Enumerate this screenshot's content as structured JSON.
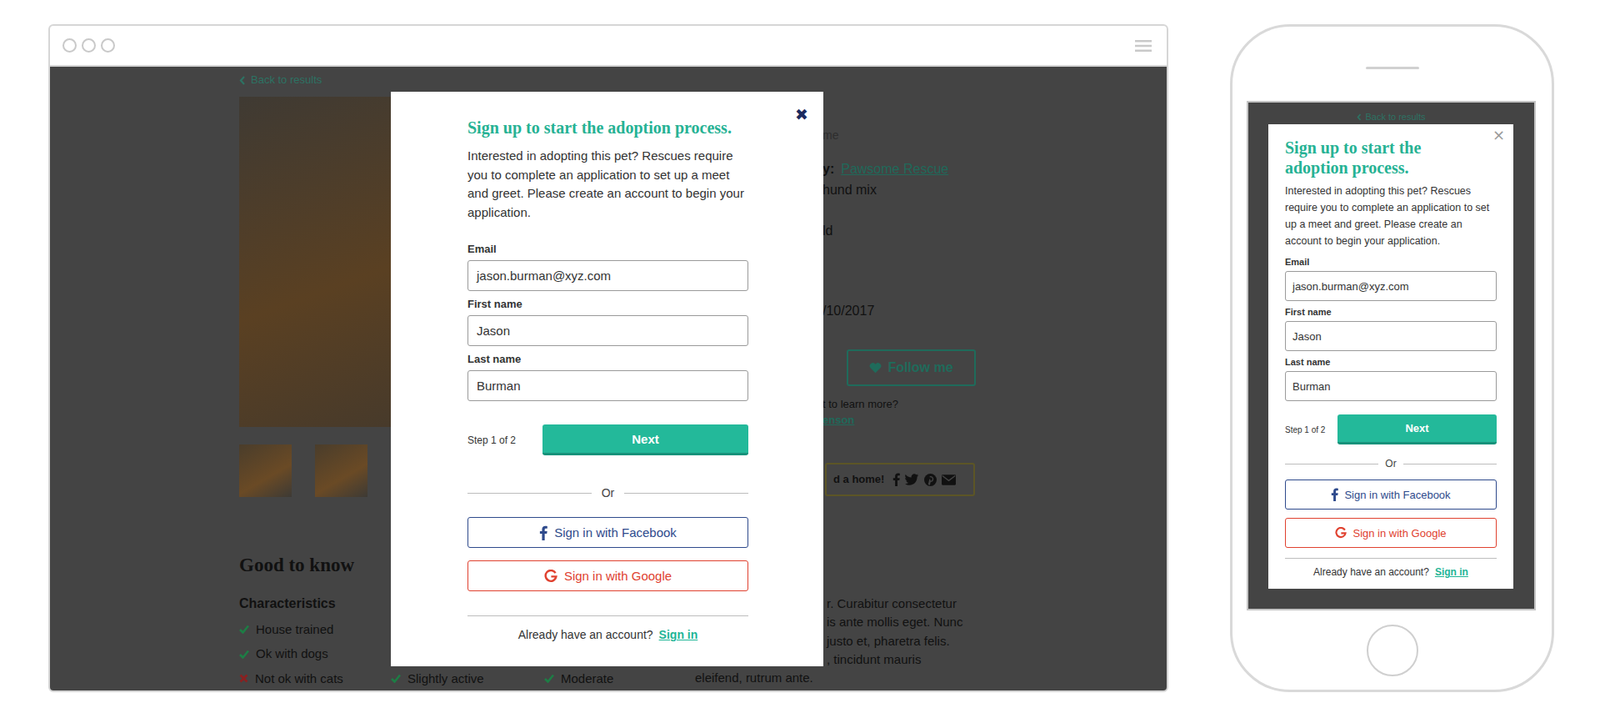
{
  "page": {
    "back_link": "Back to results",
    "details": {
      "faded": "me",
      "rescue_label": "y:",
      "rescue_link": "Pawsome Rescue",
      "breed": "hund mix",
      "age": "ld",
      "date": "/10/2017",
      "follow": "Follow me",
      "learn_more": "t to learn more?",
      "contact_link": "enson",
      "share_text": "d a home!"
    },
    "good_to_know": "Good to know",
    "characteristics": "Characteristics",
    "trait_columns": [
      [
        {
          "label": "House trained",
          "ok": true
        },
        {
          "label": "Ok with dogs",
          "ok": true
        },
        {
          "label": "Not ok with cats",
          "ok": false
        }
      ],
      [
        {
          "label": "Slightly active",
          "ok": true
        }
      ],
      [
        {
          "label": "Moderate",
          "ok": true
        }
      ]
    ],
    "bio_lines": [
      "r. Curabitur consectetur",
      "is ante mollis eget. Nunc",
      "justo et, pharetra felis.",
      ", tincidunt mauris",
      "eleifend, rutrum ante."
    ]
  },
  "modal": {
    "close": "✖",
    "title": "Sign up to start the adoption process.",
    "intro": "Interested in adopting this pet? Rescues require you to complete an application to set up a meet and greet. Please create an account to begin your application.",
    "fields": [
      {
        "label": "Email",
        "value": "jason.burman@xyz.com"
      },
      {
        "label": "First name",
        "value": "Jason"
      },
      {
        "label": "Last name",
        "value": "Burman"
      }
    ],
    "step": "Step 1 of 2",
    "next": "Next",
    "divider": "Or",
    "social": [
      {
        "label": "Sign in with Facebook",
        "kind": "facebook",
        "color": "#2e4a8c"
      },
      {
        "label": "Sign in with Google",
        "kind": "google",
        "color": "#e0412f"
      }
    ],
    "footer": {
      "prompt": "Already have an account?",
      "link": "Sign in"
    }
  },
  "mobile": {
    "back_link": "Back to results",
    "close": "×"
  }
}
